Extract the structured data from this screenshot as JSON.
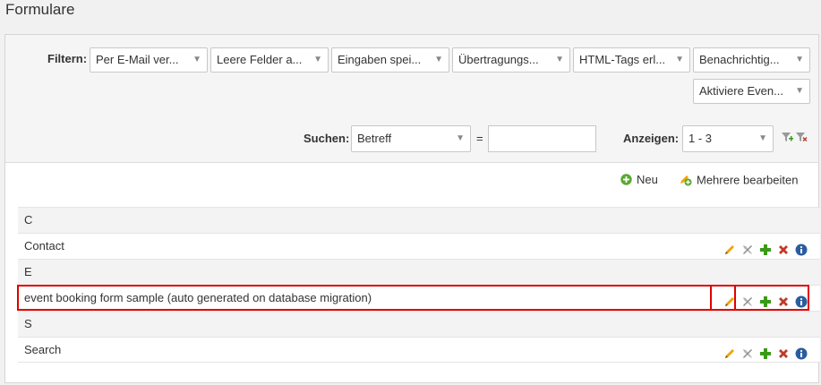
{
  "page": {
    "title": "Formulare"
  },
  "filters": {
    "label": "Filtern:",
    "selects": [
      "Per E-Mail ver...",
      "Leere Felder a...",
      "Eingaben spei...",
      "Übertragungs...",
      "HTML-Tags erl...",
      "Benachrichtig...",
      "Aktiviere Even..."
    ]
  },
  "search": {
    "label": "Suchen:",
    "field_value": "Betreff",
    "operator": "=",
    "text_value": "",
    "show_label": "Anzeigen:",
    "show_value": "1 - 3"
  },
  "actions": {
    "new_label": "Neu",
    "bulk_edit_label": "Mehrere bearbeiten"
  },
  "rows": [
    {
      "type": "group",
      "label": "C"
    },
    {
      "type": "item",
      "label": "Contact"
    },
    {
      "type": "group",
      "label": "E"
    },
    {
      "type": "item",
      "label": "event booking form sample (auto generated on database migration)"
    },
    {
      "type": "group",
      "label": "S"
    },
    {
      "type": "item",
      "label": "Search"
    }
  ],
  "colors": {
    "edit": "#f0a500",
    "add": "#3a9a17",
    "delete": "#c0392b",
    "info": "#2a5d9f",
    "highlight": "#e00000"
  }
}
